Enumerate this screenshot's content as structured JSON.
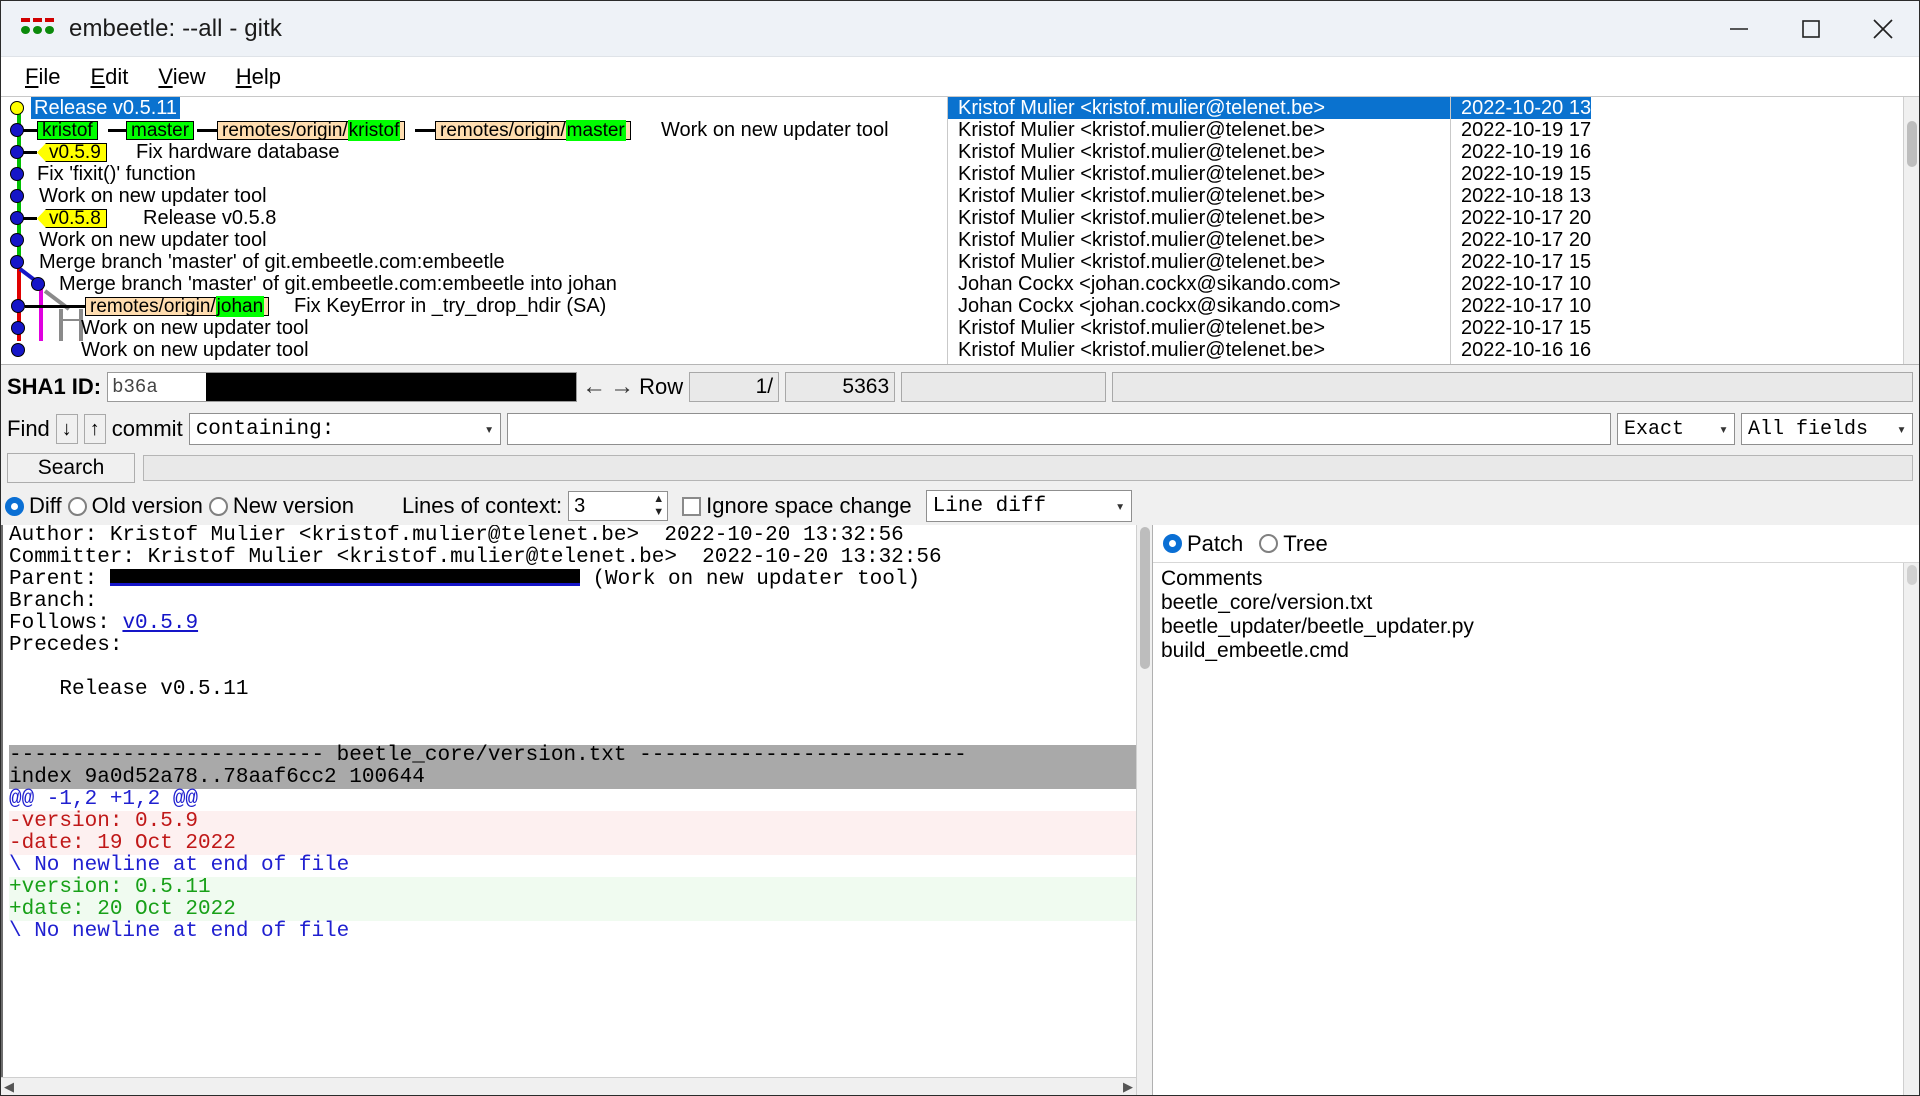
{
  "window": {
    "title": "embeetle: --all - gitk",
    "icon": "gitk-beetle-icon",
    "minimize": "minimize-icon",
    "maximize": "maximize-icon",
    "close": "close-icon"
  },
  "menubar": {
    "items": [
      {
        "label": "File",
        "mnemonic": "F",
        "rest": "ile"
      },
      {
        "label": "Edit",
        "mnemonic": "E",
        "rest": "dit"
      },
      {
        "label": "View",
        "mnemonic": "V",
        "rest": "iew"
      },
      {
        "label": "Help",
        "mnemonic": "H",
        "rest": "elp"
      }
    ]
  },
  "commit_list": {
    "rows": [
      {
        "message": "Release v0.5.11",
        "author": "Kristof Mulier <kristof.mulier@telenet.be>",
        "date": "2022-10-20 13",
        "selected": true
      },
      {
        "message": "",
        "author": "Kristof Mulier <kristof.mulier@telenet.be>",
        "date": "2022-10-19 17",
        "selected": false
      },
      {
        "message": "Fix hardware database",
        "author": "Kristof Mulier <kristof.mulier@telenet.be>",
        "date": "2022-10-19 16",
        "selected": false
      },
      {
        "message": "Fix 'fixit()' function",
        "author": "Kristof Mulier <kristof.mulier@telenet.be>",
        "date": "2022-10-19 15",
        "selected": false
      },
      {
        "message": "Work on new updater tool",
        "author": "Kristof Mulier <kristof.mulier@telenet.be>",
        "date": "2022-10-18 13",
        "selected": false
      },
      {
        "message": "Release v0.5.8",
        "author": "Kristof Mulier <kristof.mulier@telenet.be>",
        "date": "2022-10-17 20",
        "selected": false
      },
      {
        "message": "Work on new updater tool",
        "author": "Kristof Mulier <kristof.mulier@telenet.be>",
        "date": "2022-10-17 20",
        "selected": false
      },
      {
        "message": "Merge branch 'master' of git.embeetle.com:embeetle",
        "author": "Kristof Mulier <kristof.mulier@telenet.be>",
        "date": "2022-10-17 15",
        "selected": false
      },
      {
        "message": "Merge branch 'master' of git.embeetle.com:embeetle into johan",
        "author": "Johan Cockx <johan.cockx@sikando.com>",
        "date": "2022-10-17 10",
        "selected": false
      },
      {
        "message": "Fix KeyError in _try_drop_hdir (SA)",
        "author": "Johan Cockx <johan.cockx@sikando.com>",
        "date": "2022-10-17 10",
        "selected": false
      },
      {
        "message": "Work on new updater tool",
        "author": "Kristof Mulier <kristof.mulier@telenet.be>",
        "date": "2022-10-17 15",
        "selected": false
      },
      {
        "message": "Work on new updater tool",
        "author": "Kristof Mulier <kristof.mulier@telenet.be>",
        "date": "2022-10-16 16",
        "selected": false
      }
    ],
    "head_message": "Work on new updater tool",
    "refs": {
      "kristof": "kristof",
      "master": "master",
      "remote_kristof_prefix": "remotes/origin/",
      "remote_kristof_name": "kristof",
      "remote_master_prefix": "remotes/origin/",
      "remote_master_name": "master",
      "remote_johan_prefix": "remotes/origin/",
      "remote_johan_name": "johan",
      "tag_059": "v0.5.9",
      "tag_058": "v0.5.8"
    },
    "colors": {
      "selection": "#0a72cf",
      "head_branch": "#00ff00",
      "remote_branch": "#ffddb0",
      "tag": "#ffff00",
      "node": "#1616c8",
      "head_node": "#ffff00"
    }
  },
  "sha_bar": {
    "label": "SHA1 ID:",
    "value": "b36a",
    "redacted": true,
    "prev_icon": "arrow-left-icon",
    "next_icon": "arrow-right-icon",
    "row_label": "Row",
    "row_current": "1/",
    "row_total": "5363"
  },
  "find_bar": {
    "label": "Find",
    "down_icon": "arrow-down-icon",
    "up_icon": "arrow-up-icon",
    "scope": "commit",
    "mode": "containing:",
    "query": "",
    "match_type": "Exact",
    "fields": "All fields"
  },
  "search_row": {
    "button": "Search",
    "value": ""
  },
  "diff_options": {
    "diff": "Diff",
    "old_version": "Old version",
    "new_version": "New version",
    "selected": "Diff",
    "lines_of_context_label": "Lines of context:",
    "lines_of_context_value": "3",
    "ignore_space_change": "Ignore space change",
    "ignore_space_checked": false,
    "diff_mode": "Line diff"
  },
  "commit_details": {
    "author_label": "Author:",
    "author": "Kristof Mulier <kristof.mulier@telenet.be>",
    "author_date": "2022-10-20 13:32:56",
    "committer_label": "Committer:",
    "committer": "Kristof Mulier <kristof.mulier@telenet.be>",
    "committer_date": "2022-10-20 13:32:56",
    "parent_label": "Parent:",
    "parent_redacted": true,
    "parent_subject": "(Work on new updater tool)",
    "branch_label": "Branch:",
    "branch": "",
    "follows_label": "Follows:",
    "follows": "v0.5.9",
    "precedes_label": "Precedes:",
    "precedes": "",
    "subject": "    Release v0.5.11"
  },
  "diff": {
    "file_header": "------------------------- beetle_core/version.txt --------------------------",
    "index_line": "index 9a0d52a78..78aaf6cc2 100644",
    "hunk": "@@ -1,2 +1,2 @@",
    "lines": [
      {
        "text": "-version: 0.5.9",
        "kind": "del"
      },
      {
        "text": "-date: 19 Oct 2022",
        "kind": "del"
      },
      {
        "text": "\\ No newline at end of file",
        "kind": "note"
      },
      {
        "text": "+version: 0.5.11",
        "kind": "add"
      },
      {
        "text": "+date: 20 Oct 2022",
        "kind": "add"
      },
      {
        "text": "\\ No newline at end of file",
        "kind": "note"
      }
    ],
    "colors": {
      "add": "#18a018",
      "del": "#c01818",
      "note": "#2020d0",
      "file_bg": "#a9a9a9"
    }
  },
  "file_panel": {
    "patch_label": "Patch",
    "tree_label": "Tree",
    "selected_view": "Patch",
    "files": [
      {
        "name": "Comments",
        "selected": true
      },
      {
        "name": "beetle_core/version.txt",
        "selected": false
      },
      {
        "name": "beetle_updater/beetle_updater.py",
        "selected": false
      },
      {
        "name": "build_embeetle.cmd",
        "selected": false
      }
    ]
  }
}
